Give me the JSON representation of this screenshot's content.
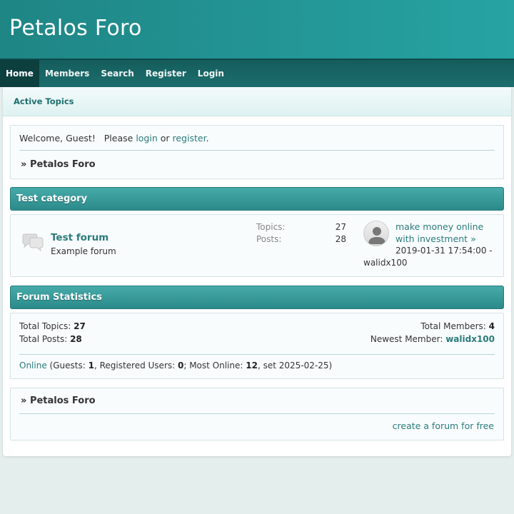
{
  "site": {
    "title": "Petalos Foro"
  },
  "nav": [
    {
      "label": "Home",
      "active": true
    },
    {
      "label": "Members"
    },
    {
      "label": "Search"
    },
    {
      "label": "Register"
    },
    {
      "label": "Login"
    }
  ],
  "subnav": {
    "active_topics": "Active Topics"
  },
  "welcome": {
    "prefix": "Welcome, Guest!   Please ",
    "login": "login",
    "or": " or ",
    "register": "register",
    "suffix": "."
  },
  "breadcrumb": {
    "sep": "» ",
    "label": "Petalos Foro"
  },
  "category": {
    "title": "Test category",
    "forums": [
      {
        "name": "Test forum",
        "description": "Example forum",
        "topics_label": "Topics:",
        "topics": "27",
        "posts_label": "Posts:",
        "posts": "28",
        "last_post": {
          "title": "make money online with investment",
          "arrow": "»",
          "date": "2019-01-31 17:54:00 -",
          "user": "walidx100"
        }
      }
    ]
  },
  "statistics": {
    "title": "Forum Statistics",
    "total_topics_label": "Total Topics: ",
    "total_topics": "27",
    "total_posts_label": "Total Posts: ",
    "total_posts": "28",
    "total_members_label": "Total Members: ",
    "total_members": "4",
    "newest_member_label": "Newest Member: ",
    "newest_member": "walidx100",
    "online_link": "Online",
    "guests_label": " (Guests: ",
    "guests": "1",
    "registered_label": ", Registered Users: ",
    "registered": "0",
    "most_online_label": "; Most Online: ",
    "most_online": "12",
    "most_online_date": ", set 2025-02-25)"
  },
  "footer": {
    "create_link": "create a forum for free"
  },
  "colors": {
    "banner": "#27a3a3",
    "nav": "#1c6e6e",
    "link": "#2a7b7b"
  },
  "icons": {
    "forum": "speech-bubbles-icon",
    "avatar": "user-silhouette-icon"
  }
}
